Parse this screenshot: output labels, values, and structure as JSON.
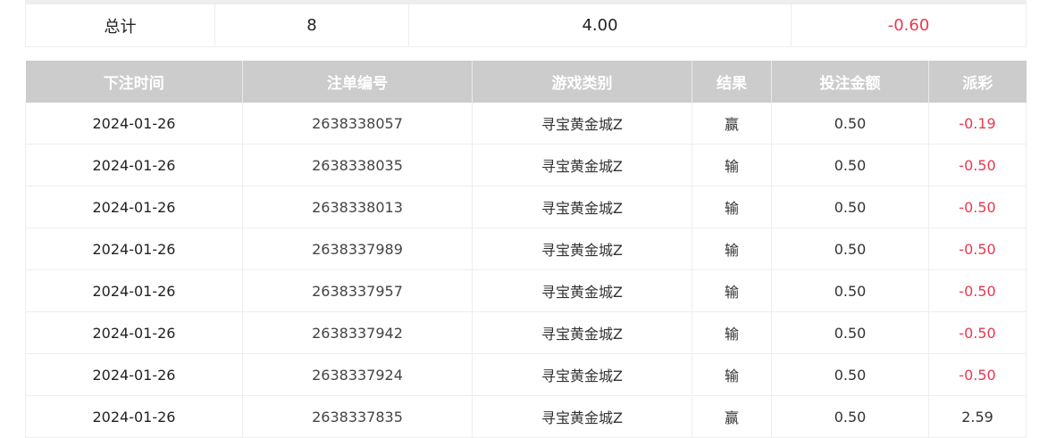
{
  "summary": {
    "label": "总计",
    "count": "8",
    "bet_total": "4.00",
    "payout_total": "-0.60"
  },
  "table": {
    "headers": [
      "下注时间",
      "注单编号",
      "游戏类别",
      "结果",
      "投注金额",
      "派彩"
    ],
    "rows": [
      {
        "date": "2024-01-26",
        "id": "2638338057",
        "game": "寻宝黄金城Z",
        "result": "赢",
        "amount": "0.50",
        "payout": "-0.19",
        "negative": true
      },
      {
        "date": "2024-01-26",
        "id": "2638338035",
        "game": "寻宝黄金城Z",
        "result": "输",
        "amount": "0.50",
        "payout": "-0.50",
        "negative": true
      },
      {
        "date": "2024-01-26",
        "id": "2638338013",
        "game": "寻宝黄金城Z",
        "result": "输",
        "amount": "0.50",
        "payout": "-0.50",
        "negative": true
      },
      {
        "date": "2024-01-26",
        "id": "2638337989",
        "game": "寻宝黄金城Z",
        "result": "输",
        "amount": "0.50",
        "payout": "-0.50",
        "negative": true
      },
      {
        "date": "2024-01-26",
        "id": "2638337957",
        "game": "寻宝黄金城Z",
        "result": "输",
        "amount": "0.50",
        "payout": "-0.50",
        "negative": true
      },
      {
        "date": "2024-01-26",
        "id": "2638337942",
        "game": "寻宝黄金城Z",
        "result": "输",
        "amount": "0.50",
        "payout": "-0.50",
        "negative": true
      },
      {
        "date": "2024-01-26",
        "id": "2638337924",
        "game": "寻宝黄金城Z",
        "result": "输",
        "amount": "0.50",
        "payout": "-0.50",
        "negative": true
      },
      {
        "date": "2024-01-26",
        "id": "2638337835",
        "game": "寻宝黄金城Z",
        "result": "赢",
        "amount": "0.50",
        "payout": "2.59",
        "negative": false
      }
    ]
  },
  "colors": {
    "header_bg": "#cccccc",
    "negative": "#e8394d",
    "border": "#eeeeee"
  }
}
